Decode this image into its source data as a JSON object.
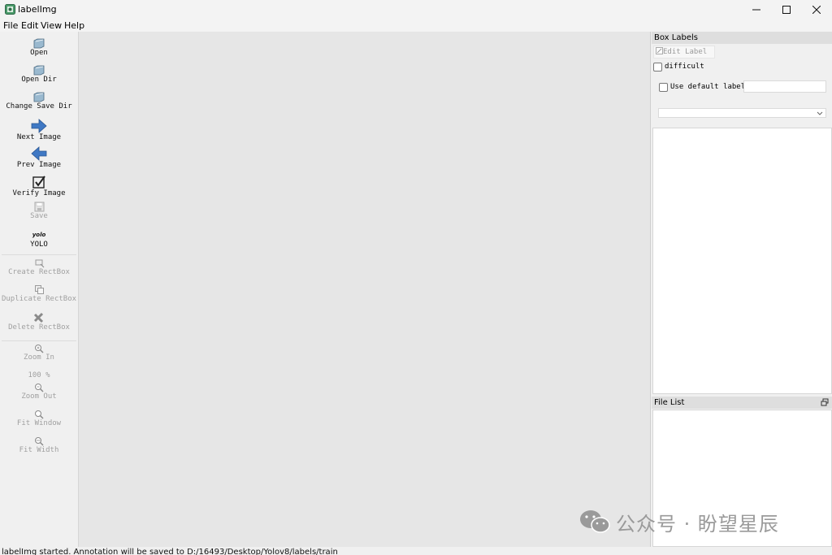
{
  "window": {
    "title": "labelImg"
  },
  "menu": [
    {
      "label": "File"
    },
    {
      "label": "Edit"
    },
    {
      "label": "View"
    },
    {
      "label": "Help"
    }
  ],
  "toolbar": {
    "open": "Open",
    "open_dir": "Open Dir",
    "change_save_dir": "Change Save Dir",
    "next_image": "Next Image",
    "prev_image": "Prev Image",
    "verify_image": "Verify Image",
    "save": "Save",
    "format_icon_text": "yolo",
    "format": "YOLO",
    "create_rectbox": "Create RectBox",
    "duplicate_rectbox": "Duplicate RectBox",
    "delete_rectbox": "Delete RectBox",
    "zoom_in": "Zoom In",
    "zoom_level": "100 %",
    "zoom_out": "Zoom Out",
    "fit_window": "Fit Window",
    "fit_width": "Fit Width"
  },
  "box_labels": {
    "title": "Box Labels",
    "edit_label": "Edit Label",
    "difficult": "difficult",
    "use_default_label": "Use default label",
    "default_label_value": ""
  },
  "file_list": {
    "title": "File List"
  },
  "status": {
    "text": "labelImg started. Annotation will be saved to D:/16493/Desktop/Yolov8/labels/train"
  },
  "watermark": {
    "text": "公众号 · 盼望星辰"
  },
  "colors": {
    "accent_blue": "#3f78c4",
    "canvas": "#e6e6e6"
  }
}
